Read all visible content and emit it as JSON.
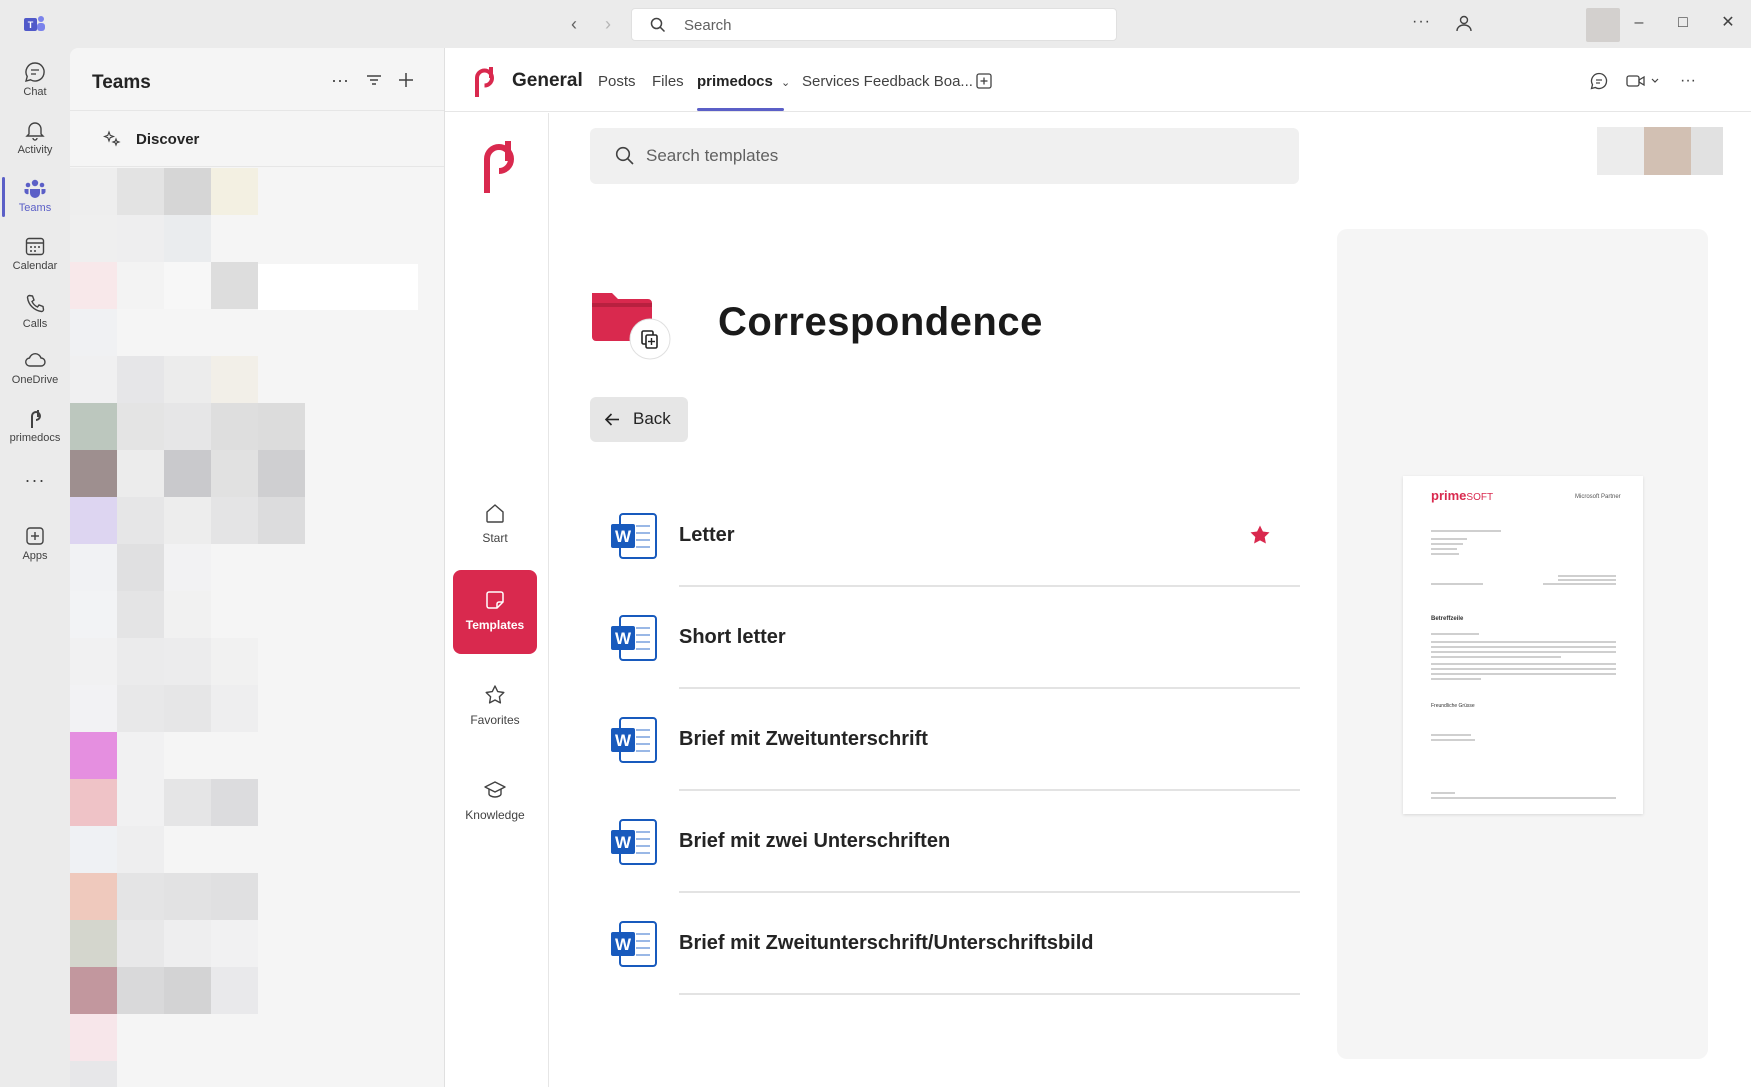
{
  "titlebar": {
    "search_placeholder": "Search",
    "more_label": "···"
  },
  "appbar": {
    "items": [
      {
        "label": "Chat",
        "icon": "chat-icon"
      },
      {
        "label": "Activity",
        "icon": "bell-icon"
      },
      {
        "label": "Teams",
        "icon": "teams-icon",
        "active": true
      },
      {
        "label": "Calendar",
        "icon": "calendar-icon"
      },
      {
        "label": "Calls",
        "icon": "phone-icon"
      },
      {
        "label": "OneDrive",
        "icon": "cloud-icon"
      },
      {
        "label": "primedocs",
        "icon": "primedocs-icon"
      },
      {
        "label": "",
        "icon": "more-icon"
      },
      {
        "label": "Apps",
        "icon": "apps-icon"
      }
    ]
  },
  "teams_panel": {
    "title": "Teams",
    "discover_label": "Discover"
  },
  "channel": {
    "name": "General",
    "tabs": [
      {
        "label": "Posts"
      },
      {
        "label": "Files"
      },
      {
        "label": "primedocs",
        "active": true
      },
      {
        "label": "Services Feedback Boa..."
      }
    ]
  },
  "primedocs_nav": {
    "items": [
      {
        "label": "Start",
        "icon": "home-icon"
      },
      {
        "label": "Templates",
        "icon": "templates-icon",
        "active": true
      },
      {
        "label": "Favorites",
        "icon": "star-icon"
      },
      {
        "label": "Knowledge",
        "icon": "graduation-cap-icon"
      }
    ]
  },
  "search": {
    "placeholder": "Search templates"
  },
  "folder": {
    "title": "Correspondence",
    "back_label": "Back"
  },
  "templates": [
    {
      "name": "Letter",
      "favorite": true
    },
    {
      "name": "Short letter",
      "favorite": false
    },
    {
      "name": "Brief mit Zweitunterschrift",
      "favorite": false
    },
    {
      "name": "Brief mit zwei Unterschriften",
      "favorite": false
    },
    {
      "name": "Brief mit Zweitunterschrift/Unterschriftsbild",
      "favorite": false
    }
  ],
  "preview": {
    "brand_prime": "prime",
    "brand_soft": "SOFT",
    "partner": "Microsoft Partner",
    "subject": "Betreffzeile",
    "greeting": "Freundliche Grüsse"
  },
  "colors": {
    "accent": "#5b5fc7",
    "brand": "#d9294e",
    "word_blue": "#185abd"
  }
}
